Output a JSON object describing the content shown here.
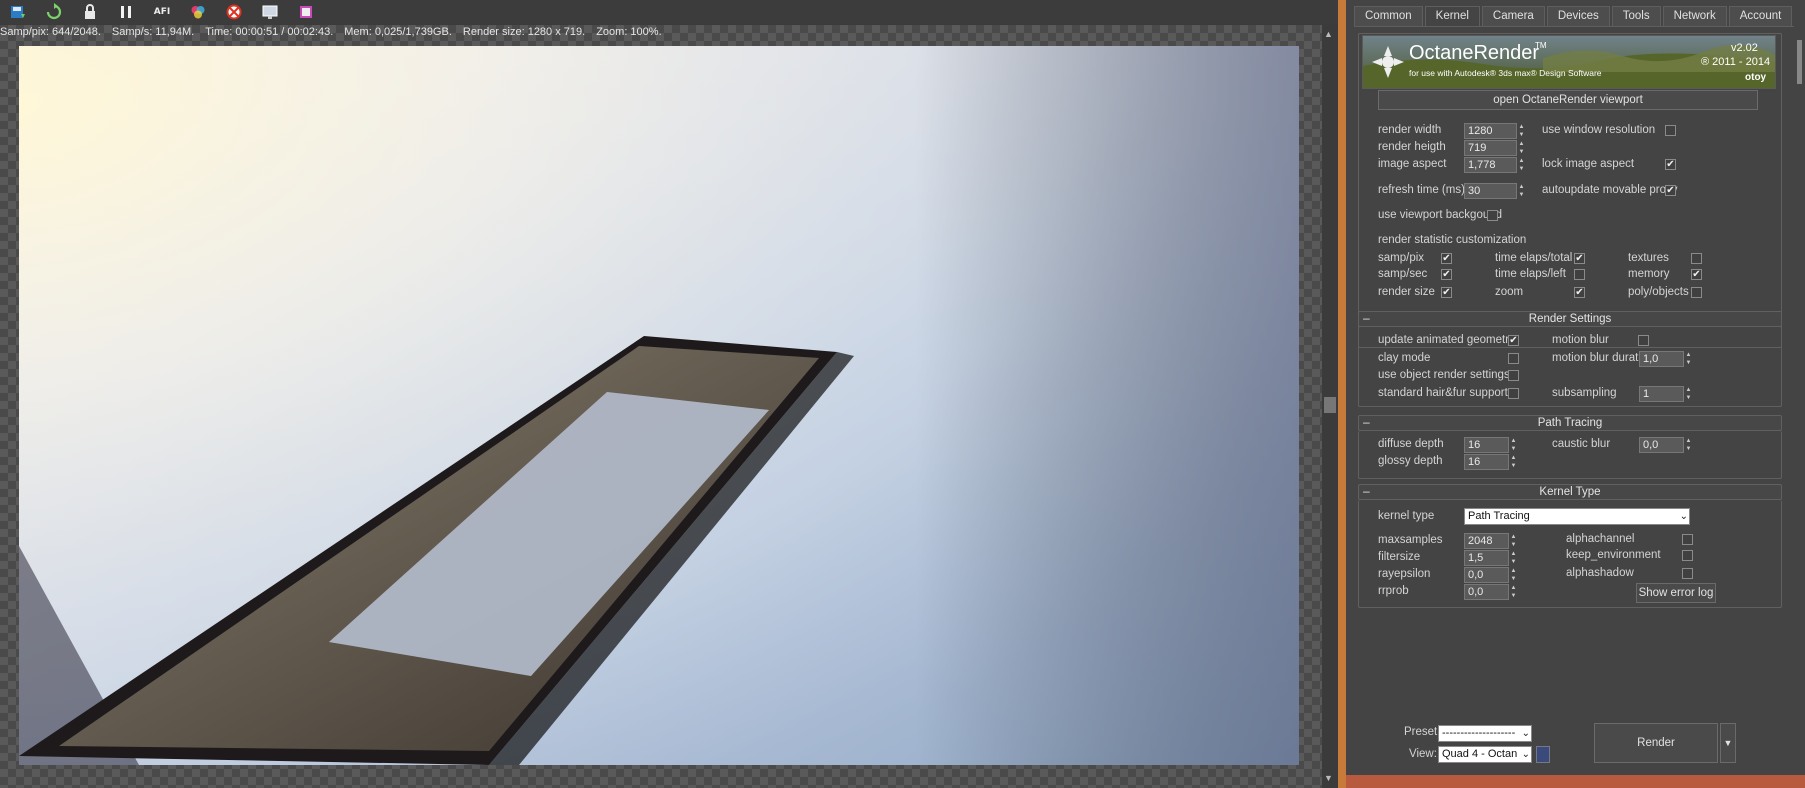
{
  "viewer": {
    "status": {
      "samp_pix": "Samp/pix: 644/2048.",
      "samp_s": "Samp/s: 11,94M.",
      "time": "Time: 00:00:51 / 00:02:43.",
      "mem": "Mem: 0,025/1,739GB.",
      "render_size": "Render size: 1280 x 719.",
      "zoom": "Zoom: 100%."
    },
    "toolbar_icons": [
      "save-icon",
      "refresh-icon",
      "lock-icon",
      "pause-icon",
      "afi-icon",
      "color-wheel-icon",
      "region-icon",
      "display-icon",
      "film-icon"
    ],
    "afi_label": "AFI"
  },
  "panel": {
    "tabs": [
      "Common",
      "Kernel",
      "Camera",
      "Devices",
      "Tools",
      "Network",
      "Account"
    ],
    "active_tab": "Kernel",
    "banner": {
      "title": "OctaneRender",
      "tm": "TM",
      "subtitle": "for use with Autodesk® 3ds max® Design Software",
      "version": "v2.02",
      "years": "® 2011 - 2014",
      "brand": "otoy"
    },
    "open_viewport": "open OctaneRender viewport",
    "common": {
      "render_width": {
        "label": "render width",
        "value": "1280"
      },
      "render_height": {
        "label": "render heigth",
        "value": "719"
      },
      "image_aspect": {
        "label": "image aspect",
        "value": "1,778"
      },
      "refresh_time": {
        "label": "refresh time (ms)",
        "value": "30"
      },
      "use_window_resolution": {
        "label": "use window resolution",
        "checked": false
      },
      "lock_image_aspect": {
        "label": "lock image aspect",
        "checked": true
      },
      "autoupdate_proxy": {
        "label": "autoupdate movable proxy",
        "checked": true
      },
      "use_viewport_bg": {
        "label": "use viewport backgound",
        "checked": false
      },
      "stat_header": "render statistic customization",
      "stats": [
        {
          "label": "samp/pix",
          "checked": true
        },
        {
          "label": "time elaps/total",
          "checked": true
        },
        {
          "label": "textures",
          "checked": false
        },
        {
          "label": "samp/sec",
          "checked": true
        },
        {
          "label": "time elaps/left",
          "checked": false
        },
        {
          "label": "memory",
          "checked": true
        },
        {
          "label": "render size",
          "checked": true
        },
        {
          "label": "zoom",
          "checked": true
        },
        {
          "label": "poly/objects",
          "checked": false
        }
      ]
    },
    "render_settings": {
      "title": "Render Settings",
      "update_anim": {
        "label": "update animated geometry",
        "checked": true
      },
      "clay_mode": {
        "label": "clay mode",
        "checked": false
      },
      "use_obj_settings": {
        "label": "use object render settings",
        "checked": false
      },
      "hair_fur": {
        "label": "standard hair&fur support",
        "checked": false
      },
      "motion_blur": {
        "label": "motion blur",
        "checked": false
      },
      "motion_blur_duration": {
        "label": "motion blur duration",
        "value": "1,0"
      },
      "subsampling": {
        "label": "subsampling",
        "value": "1"
      }
    },
    "path_tracing": {
      "title": "Path Tracing",
      "diffuse_depth": {
        "label": "diffuse depth",
        "value": "16"
      },
      "glossy_depth": {
        "label": "glossy depth",
        "value": "16"
      },
      "caustic_blur": {
        "label": "caustic blur",
        "value": "0,0"
      }
    },
    "kernel_type": {
      "title": "Kernel Type",
      "kernel_type": {
        "label": "kernel type",
        "value": "Path Tracing"
      },
      "maxsamples": {
        "label": "maxsamples",
        "value": "2048"
      },
      "filtersize": {
        "label": "filtersize",
        "value": "1,5"
      },
      "rayepsilon": {
        "label": "rayepsilon",
        "value": "0,0"
      },
      "rrprob": {
        "label": "rrprob",
        "value": "0,0"
      },
      "alphachannel": {
        "label": "alphachannel",
        "checked": false
      },
      "keep_environment": {
        "label": "keep_environment",
        "checked": false
      },
      "alphashadow": {
        "label": "alphashadow",
        "checked": false
      },
      "error_log": "Show error log"
    },
    "bottom": {
      "preset_label": "Preset:",
      "preset_value": "--------------------",
      "view_label": "View:",
      "view_value": "Quad 4 - Octan",
      "render_button": "Render"
    },
    "collapse_glyph": "–",
    "check_glyph": "✔",
    "spin_up": "▲",
    "spin_down": "▼",
    "dropdown_glyph": "⌄"
  },
  "colors": {
    "accent_divider": "#c77a3a",
    "panel_bg": "#444444",
    "footer_strip": "#b85a3e"
  }
}
